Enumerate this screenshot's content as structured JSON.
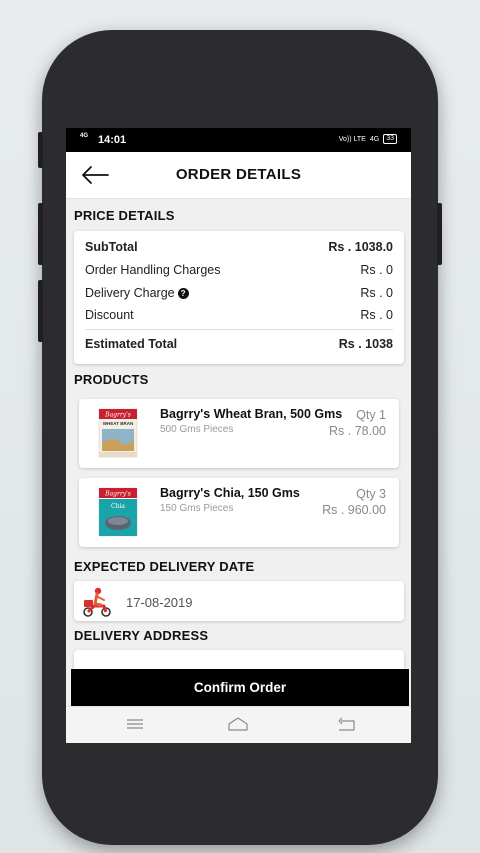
{
  "status_bar": {
    "network": "4G",
    "time": "14:01",
    "volte": "Vo)) LTE",
    "right_network": "4G",
    "battery": "33"
  },
  "header": {
    "title": "ORDER DETAILS",
    "back_icon": "arrow-left-icon"
  },
  "price_details": {
    "section_title": "PRICE DETAILS",
    "rows": [
      {
        "label": "SubTotal",
        "value": "Rs . 1038.0"
      },
      {
        "label": "Order Handling Charges",
        "value": "Rs . 0"
      },
      {
        "label": "Delivery Charge",
        "value": "Rs . 0"
      },
      {
        "label": "Discount",
        "value": "Rs . 0"
      }
    ],
    "total": {
      "label": "Estimated Total",
      "value": "Rs . 1038"
    }
  },
  "products": {
    "section_title": "PRODUCTS",
    "items": [
      {
        "name": "Bagrry's Wheat Bran, 500 Gms",
        "subtitle": "500 Gms Pieces",
        "qty": "Qty 1",
        "price": "Rs . 78.00",
        "brand": "Bagrry's",
        "pack_label": "WHEAT BRAN"
      },
      {
        "name": "Bagrry's Chia, 150 Gms",
        "subtitle": "150 Gms Pieces",
        "qty": "Qty 3",
        "price": "Rs . 960.00",
        "brand": "Bagrry's",
        "pack_label": "Chia"
      }
    ]
  },
  "delivery": {
    "section_title": "EXPECTED DELIVERY DATE",
    "date": "17-08-2019",
    "icon": "delivery-scooter-icon"
  },
  "address": {
    "section_title": "DELIVERY ADDRESS"
  },
  "confirm_button": {
    "label": "Confirm Order"
  },
  "colors": {
    "confirm_bg": "#000000",
    "brand_red": "#c8202f",
    "chia_teal": "#1aa3a8"
  }
}
